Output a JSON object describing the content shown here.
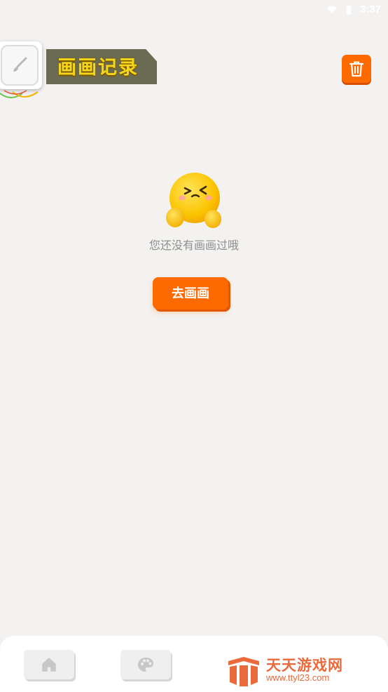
{
  "status_bar": {
    "time": "3:37",
    "wifi_icon": "wifi-icon",
    "battery_icon": "battery-icon"
  },
  "header": {
    "title": "画画记录",
    "brush_icon": "paintbrush-icon",
    "delete_icon": "trash-icon",
    "title_color": "#f5d619",
    "accent": "#ff6a00"
  },
  "empty_state": {
    "emoji": "shy-face-emoji",
    "message": "您还没有画画过哦",
    "button_label": "去画画"
  },
  "bottom_nav": {
    "items": [
      {
        "icon": "home-icon"
      },
      {
        "icon": "palette-icon"
      }
    ]
  },
  "watermark": {
    "name": "天天游戏网",
    "url": "www.ttyl23.com",
    "color": "#ea6a3b"
  }
}
